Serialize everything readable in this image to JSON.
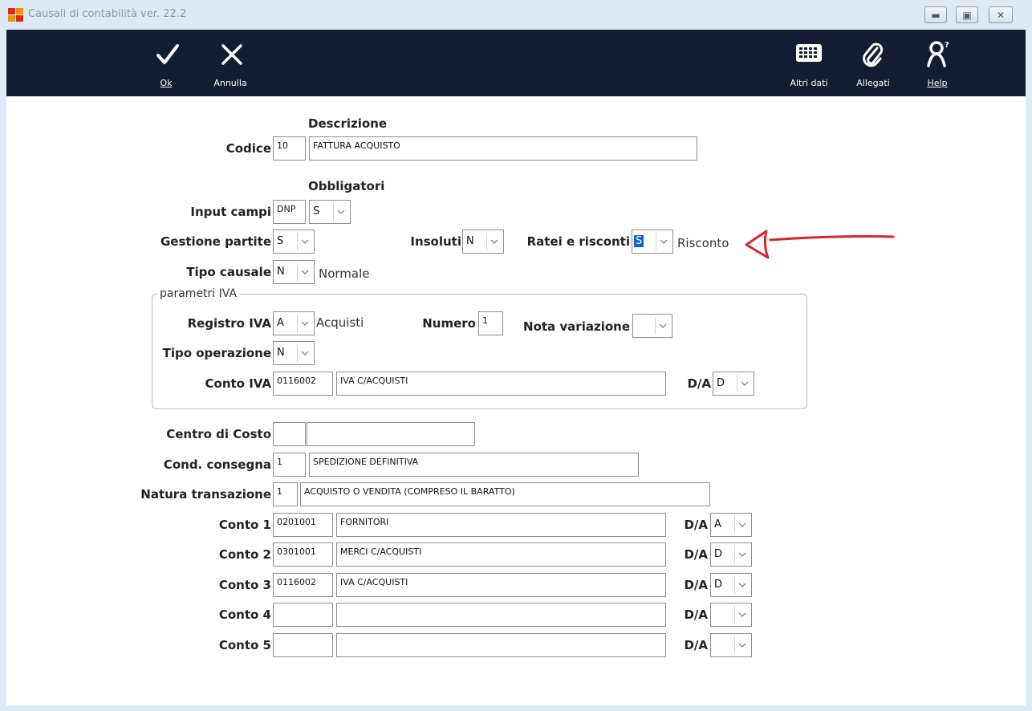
{
  "window": {
    "title": "Causali di contabilità ver. 22.2"
  },
  "toolbar": {
    "ok_label": "Ok",
    "annulla_label": "Annulla",
    "altri_dati_label": "Altri dati",
    "allegati_label": "Allegati",
    "help_label": "Help"
  },
  "form": {
    "descrizione_header": "Descrizione",
    "codice_label": "Codice",
    "codice_value": "10",
    "descrizione_value": "FATTURA ACQUISTO",
    "obbligatori_header": "Obbligatori",
    "input_campi_label": "Input campi",
    "input_campi_value": "DNP",
    "input_campi_select": "S",
    "gestione_partite_label": "Gestione partite",
    "gestione_partite_value": "S",
    "insoluti_label": "Insoluti",
    "insoluti_value": "N",
    "ratei_label": "Ratei e risconti",
    "ratei_value": "S",
    "ratei_desc": "Risconto",
    "tipo_causale_label": "Tipo causale",
    "tipo_causale_value": "N",
    "tipo_causale_desc": "Normale"
  },
  "iva": {
    "group_title": "parametri IVA",
    "registro_label": "Registro IVA",
    "registro_value": "A",
    "registro_desc": "Acquisti",
    "numero_label": "Numero",
    "numero_value": "1",
    "nota_label": "Nota variazione",
    "nota_value": "",
    "tipo_operazione_label": "Tipo operazione",
    "tipo_operazione_value": "N",
    "conto_label": "Conto IVA",
    "conto_code": "0116002",
    "conto_desc": "IVA C/ACQUISTI",
    "da_label": "D/A",
    "da_value": "D"
  },
  "extra": {
    "centro_label": "Centro di Costo",
    "centro_code": "",
    "centro_desc": "",
    "consegna_label": "Cond. consegna",
    "consegna_code": "1",
    "consegna_desc": "SPEDIZIONE DEFINITIVA",
    "natura_label": "Natura transazione",
    "natura_code": "1",
    "natura_desc": "ACQUISTO O VENDITA (COMPRESO IL BARATTO)"
  },
  "conti": [
    {
      "label": "Conto 1",
      "code": "0201001",
      "desc": "FORNITORI",
      "da_label": "D/A",
      "da": "A"
    },
    {
      "label": "Conto 2",
      "code": "0301001",
      "desc": "MERCI C/ACQUISTI",
      "da_label": "D/A",
      "da": "D"
    },
    {
      "label": "Conto 3",
      "code": "0116002",
      "desc": "IVA C/ACQUISTI",
      "da_label": "D/A",
      "da": "D"
    },
    {
      "label": "Conto 4",
      "code": "",
      "desc": "",
      "da_label": "D/A",
      "da": ""
    },
    {
      "label": "Conto 5",
      "code": "",
      "desc": "",
      "da_label": "D/A",
      "da": ""
    }
  ],
  "colors": {
    "toolbar_bg": "#141b33",
    "selection": "#0a64d6",
    "annotation_arrow": "#d9262b"
  }
}
